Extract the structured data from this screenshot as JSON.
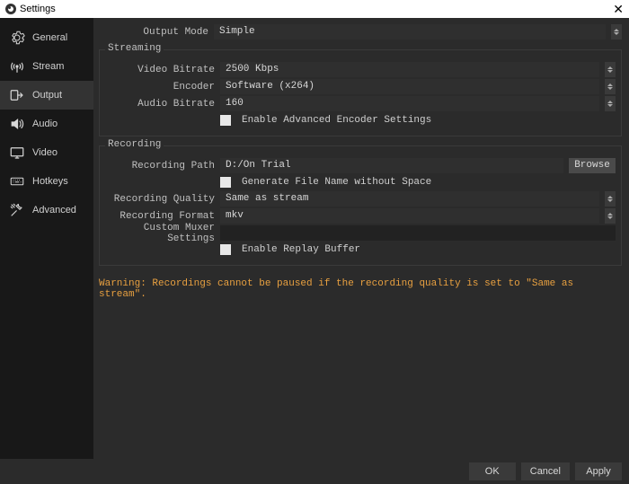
{
  "window": {
    "title": "Settings"
  },
  "sidebar": {
    "items": [
      {
        "label": "General"
      },
      {
        "label": "Stream"
      },
      {
        "label": "Output"
      },
      {
        "label": "Audio"
      },
      {
        "label": "Video"
      },
      {
        "label": "Hotkeys"
      },
      {
        "label": "Advanced"
      }
    ]
  },
  "output_mode": {
    "label": "Output Mode",
    "value": "Simple"
  },
  "streaming": {
    "title": "Streaming",
    "video_bitrate": {
      "label": "Video Bitrate",
      "value": "2500 Kbps"
    },
    "encoder": {
      "label": "Encoder",
      "value": "Software (x264)"
    },
    "audio_bitrate": {
      "label": "Audio Bitrate",
      "value": "160"
    },
    "adv_encoder": {
      "label": "Enable Advanced Encoder Settings"
    }
  },
  "recording": {
    "title": "Recording",
    "path": {
      "label": "Recording Path",
      "value": "D:/On Trial",
      "browse": "Browse"
    },
    "nospace": {
      "label": "Generate File Name without Space"
    },
    "quality": {
      "label": "Recording Quality",
      "value": "Same as stream"
    },
    "format": {
      "label": "Recording Format",
      "value": "mkv"
    },
    "muxer": {
      "label": "Custom Muxer Settings",
      "value": ""
    },
    "replay": {
      "label": "Enable Replay Buffer"
    }
  },
  "warning": "Warning: Recordings cannot be paused if the recording quality is set to \"Same as stream\".",
  "footer": {
    "ok": "OK",
    "cancel": "Cancel",
    "apply": "Apply"
  }
}
